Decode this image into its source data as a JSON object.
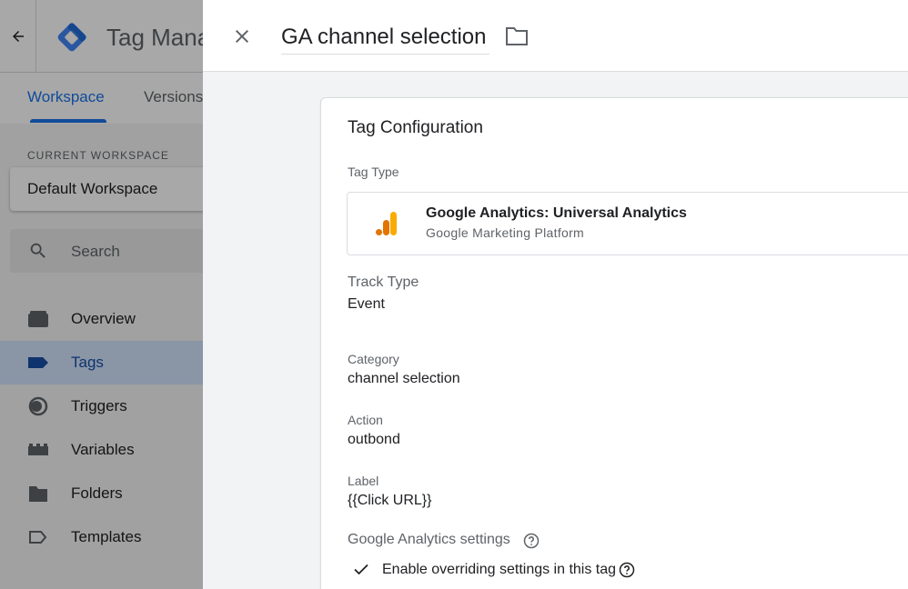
{
  "app": {
    "title": "Tag Manager",
    "tabs": [
      {
        "label": "Workspace",
        "active": true
      },
      {
        "label": "Versions",
        "active": false
      }
    ],
    "current_workspace_label": "CURRENT WORKSPACE",
    "current_workspace": "Default Workspace",
    "search_placeholder": "Search",
    "nav": [
      {
        "label": "Overview",
        "icon": "overview-icon",
        "active": false
      },
      {
        "label": "Tags",
        "icon": "tag-icon",
        "active": true
      },
      {
        "label": "Triggers",
        "icon": "trigger-icon",
        "active": false
      },
      {
        "label": "Variables",
        "icon": "variables-icon",
        "active": false
      },
      {
        "label": "Folders",
        "icon": "folder-icon",
        "active": false
      },
      {
        "label": "Templates",
        "icon": "template-icon",
        "active": false
      }
    ]
  },
  "sheet": {
    "tag_name": "GA channel selection",
    "card_title": "Tag Configuration",
    "tag_type_label": "Tag Type",
    "tag_type_name": "Google Analytics: Universal Analytics",
    "tag_type_provider": "Google Marketing Platform",
    "track_type_label": "Track Type",
    "track_type_value": "Event",
    "category_label": "Category",
    "category_value": "channel selection",
    "action_label": "Action",
    "action_value": "outbond",
    "label_label": "Label",
    "label_value": "{{Click URL}}",
    "ga_settings_label": "Google Analytics settings",
    "override_label": "Enable overriding settings in this tag",
    "override_checked": true
  },
  "colors": {
    "accent": "#1a73e8",
    "ga_orange": "#f9ab00",
    "ga_dark_orange": "#e37400"
  }
}
